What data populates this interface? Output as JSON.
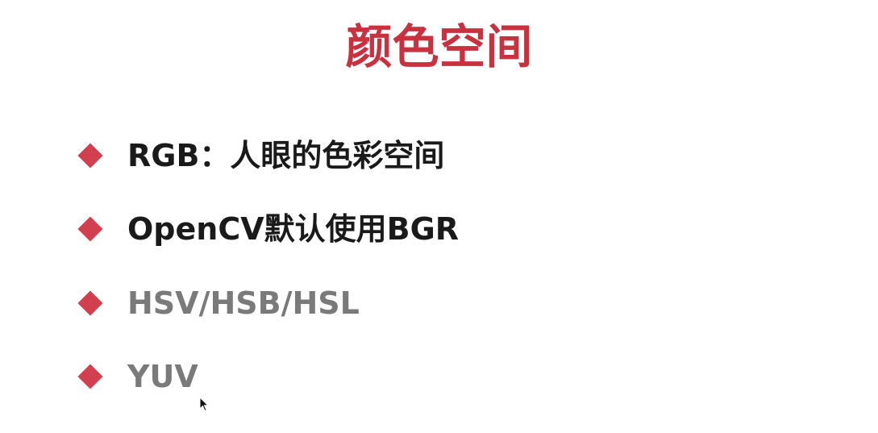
{
  "title": "颜色空间",
  "colors": {
    "title": "#c8323f",
    "bullet_marker": "#d2404f",
    "emphasized_text": "#1a1a1a",
    "muted_text": "#7a7a7a"
  },
  "bullets": [
    {
      "text": "RGB：人眼的色彩空间",
      "style": "emphasized"
    },
    {
      "text": "OpenCV默认使用BGR",
      "style": "emphasized"
    },
    {
      "text": "HSV/HSB/HSL",
      "style": "muted"
    },
    {
      "text": "YUV",
      "style": "muted"
    }
  ],
  "icons": {
    "bullet_marker": "diamond-bullet-icon",
    "pointer": "mouse-cursor-icon"
  }
}
